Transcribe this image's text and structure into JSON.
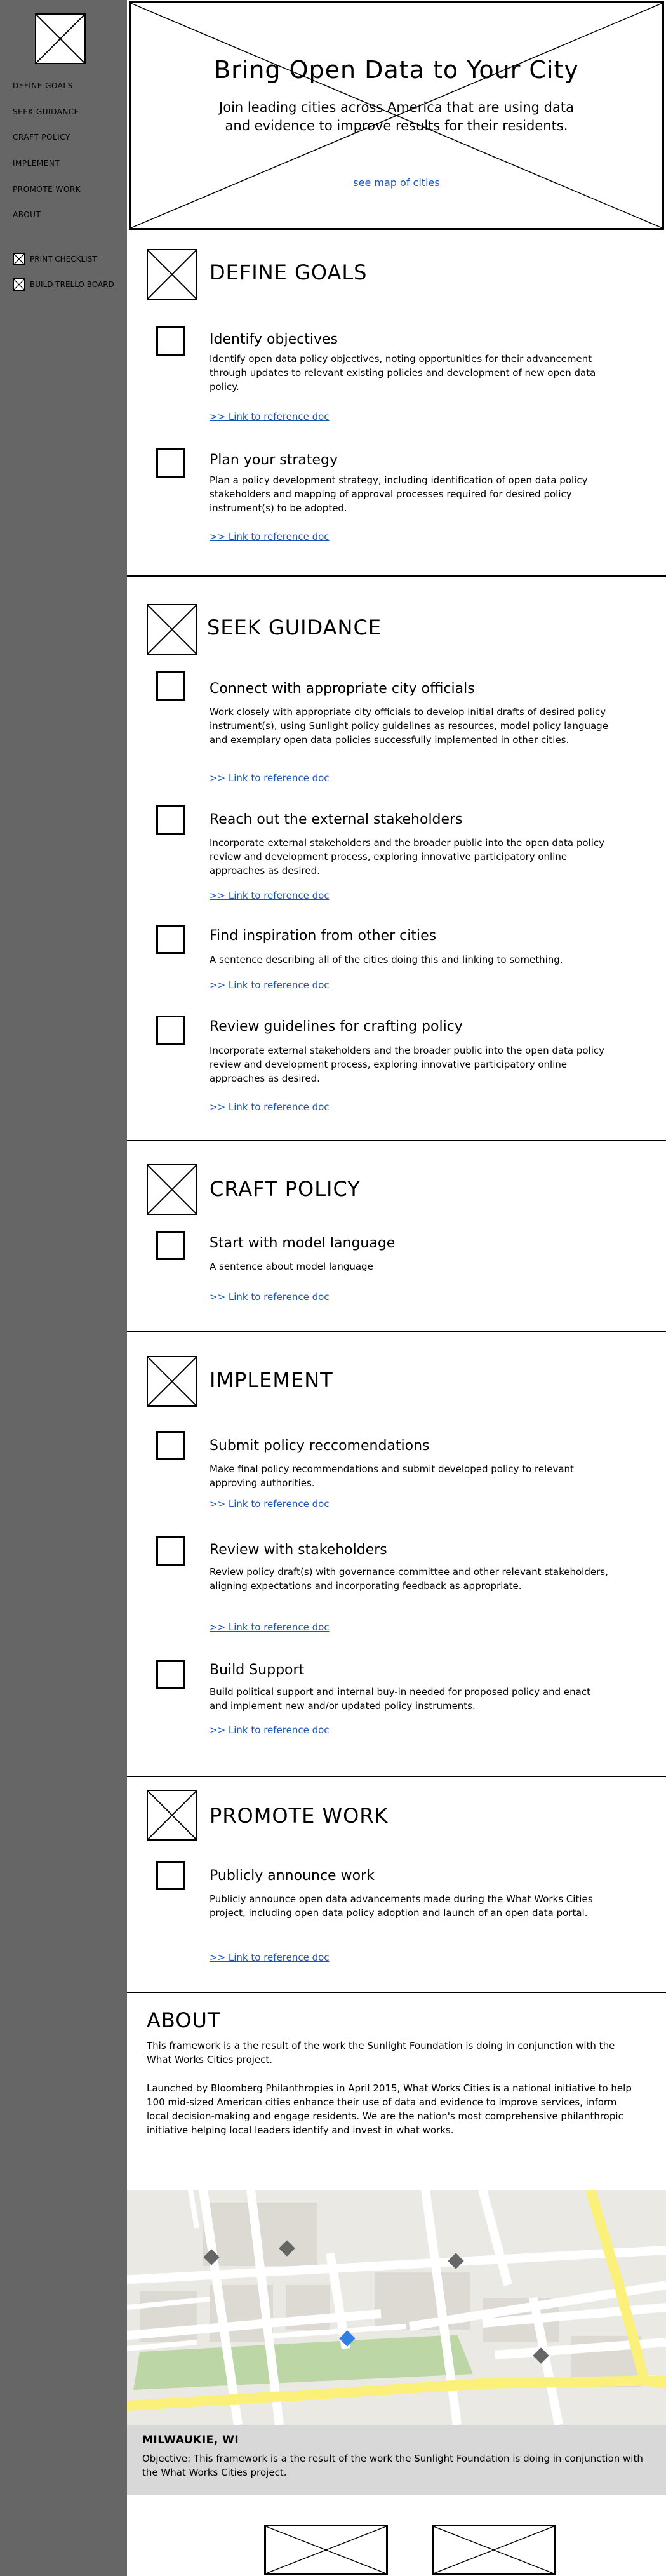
{
  "sidebar": {
    "nav": [
      "DEFINE GOALS",
      "SEEK GUIDANCE",
      "CRAFT POLICY",
      "IMPLEMENT",
      "PROMOTE WORK",
      "ABOUT"
    ],
    "tools": [
      "PRINT CHECKLIST",
      "BUILD TRELLO BOARD"
    ]
  },
  "hero": {
    "title": "Bring Open Data to Your City",
    "subtitle": "Join leading cities across America that are using data and evidence to improve results for their residents.",
    "link": "see map of cities"
  },
  "sections": [
    {
      "title": "DEFINE GOALS",
      "steps": [
        {
          "title": "Identify objectives",
          "desc": "Identify open data policy objectives, noting opportunities for their advancement through updates to relevant existing policies and development of new open data policy.",
          "link": ">> Link to reference doc"
        },
        {
          "title": "Plan your strategy",
          "desc": "Plan a policy development strategy, including identification of open data policy stakeholders and mapping of approval processes required for desired policy instrument(s) to be adopted.",
          "link": ">> Link to reference doc"
        }
      ]
    },
    {
      "title": "SEEK GUIDANCE",
      "steps": [
        {
          "title": "Connect with appropriate city officials",
          "desc": "Work closely with appropriate city officials to develop initial drafts of desired policy instrument(s), using Sunlight policy guidelines as resources, model policy language and exemplary open data policies successfully implemented in other cities.",
          "link": ">> Link to reference doc"
        },
        {
          "title": "Reach out the external stakeholders",
          "desc": "Incorporate external stakeholders and the broader public into the open data policy review and development process, exploring innovative participatory online approaches as desired.",
          "link": ">> Link to reference doc"
        },
        {
          "title": "Find inspiration from other cities",
          "desc": "A sentence describing all of the cities doing this and linking to something.",
          "link": ">> Link to reference doc"
        },
        {
          "title": "Review guidelines for crafting policy",
          "desc": "Incorporate external stakeholders and the broader public into the open data policy review and development process, exploring innovative participatory online approaches as desired.",
          "link": ">> Link to reference doc"
        }
      ]
    },
    {
      "title": "CRAFT POLICY",
      "steps": [
        {
          "title": "Start with model language",
          "desc": "A sentence about model language",
          "link": ">> Link to reference doc"
        }
      ]
    },
    {
      "title": "IMPLEMENT",
      "steps": [
        {
          "title": "Submit policy reccomendations",
          "desc": "Make final policy recommendations and submit developed policy to relevant approving authorities.",
          "link": ">> Link to reference doc"
        },
        {
          "title": "Review with stakeholders",
          "desc": "Review policy draft(s) with governance committee and other relevant stakeholders, aligning expectations and incorporating feedback as appropriate.",
          "link": ">> Link to reference doc"
        },
        {
          "title": "Build Support",
          "desc": "Build political support and internal buy-in needed for proposed policy and enact and implement new and/or updated policy instruments.",
          "link": ">> Link to reference doc"
        }
      ]
    },
    {
      "title": "PROMOTE WORK",
      "steps": [
        {
          "title": "Publicly announce work",
          "desc": "Publicly announce open data advancements made during the What Works Cities project, including open data policy adoption and launch of an open data portal.",
          "link": ">> Link to reference doc"
        }
      ]
    }
  ],
  "about": {
    "title": "ABOUT",
    "p1": "This framework is a the result of the work the Sunlight Foundation is doing in conjunction with the What Works Cities project.",
    "p2": "Launched by Bloomberg Philanthropies in April 2015, What Works Cities is a national initiative to help 100 mid-sized American cities enhance their use of data and evidence to improve services, inform local decision-making and engage residents. We are the nation's most comprehensive philanthropic initiative helping local leaders identify and invest in what works."
  },
  "map": {
    "city": "MILWAUKIE, WI",
    "caption": "Objective: This framework is a the result of the work the Sunlight Foundation is doing in conjunction with the What Works Cities project.",
    "colors": {
      "land": "#ebe9e3",
      "block": "#dcdad3",
      "park": "#bcd6a6",
      "highway": "#fbf07a",
      "marker": "#666666",
      "active_marker": "#2f7fe6"
    }
  }
}
